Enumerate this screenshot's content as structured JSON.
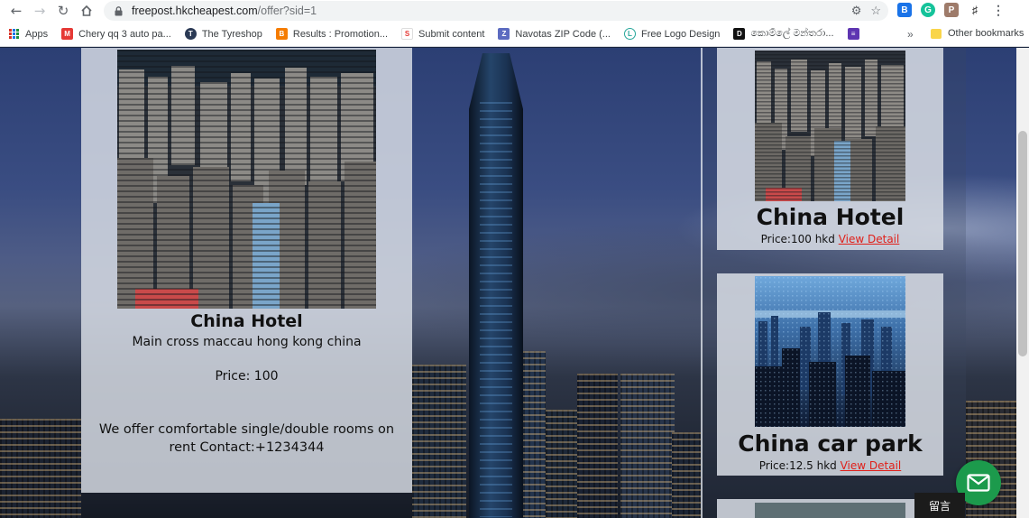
{
  "browser": {
    "url_host": "freepost.hkcheapest.com",
    "url_path": "/offer?sid=1",
    "bookmarks": [
      {
        "label": "Apps"
      },
      {
        "label": "Chery qq 3 auto pa..."
      },
      {
        "label": "The Tyreshop"
      },
      {
        "label": "Results : Promotion..."
      },
      {
        "label": "Submit content"
      },
      {
        "label": "Navotas ZIP Code (..."
      },
      {
        "label": "Free Logo Design"
      },
      {
        "label": "කොම්ලේ මන්තරා..."
      }
    ],
    "more_label": "»",
    "other_bookmarks": "Other bookmarks"
  },
  "main_listing": {
    "title": "China Hotel",
    "address": "Main cross maccau hong kong china",
    "price": "Price: 100",
    "description": "We offer comfortable single/double rooms on rent Contact:+1234344"
  },
  "side_listings": [
    {
      "title": "China Hotel",
      "price": "Price:100 hkd",
      "link": "View Detail"
    },
    {
      "title": "China car park",
      "price": "Price:12.5 hkd",
      "link": "View Detail"
    }
  ],
  "chat": {
    "label": "留言"
  },
  "colors": {
    "link": "#e0201a",
    "chat": "#1c9a4c",
    "card_bg": "#d8dde5"
  }
}
